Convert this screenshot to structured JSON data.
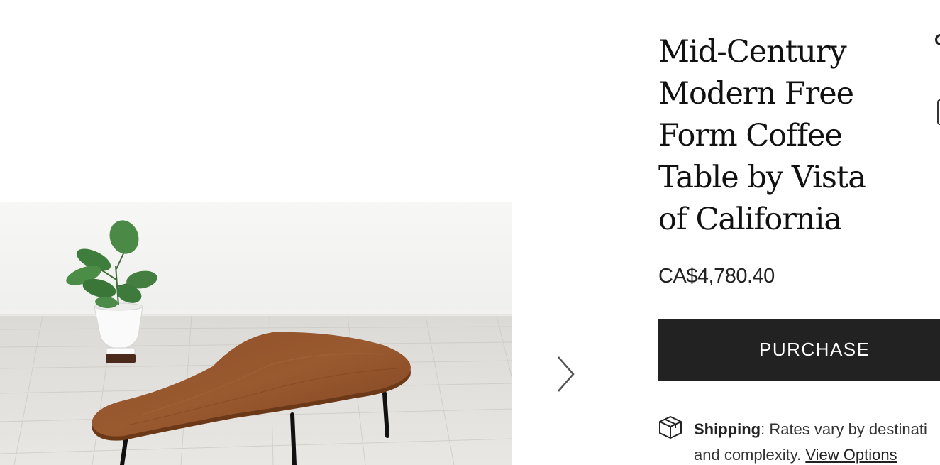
{
  "product": {
    "title": "Mid-Century Modern Free Form Coffee Table by Vista of California",
    "price": "CA$4,780.40",
    "purchase_label": "PURCHASE",
    "image_icon": "coffee-table-photo"
  },
  "gallery": {
    "next_icon": "chevron-right-icon"
  },
  "shipping": {
    "icon": "package-icon",
    "label": "Shipping",
    "text": ": Rates vary by destinati",
    "text_line2": "and complexity. ",
    "link": "View Options"
  },
  "colors": {
    "button_bg": "#222222",
    "button_text": "#ffffff",
    "wood": "#8a4a24"
  }
}
